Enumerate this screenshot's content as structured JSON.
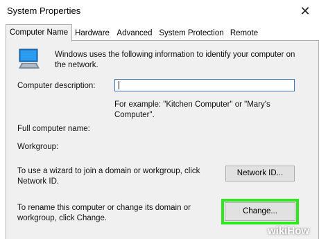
{
  "window": {
    "title": "System Properties",
    "close_glyph": "✕"
  },
  "tabs": [
    {
      "label": "Computer Name",
      "active": true
    },
    {
      "label": "Hardware",
      "active": false
    },
    {
      "label": "Advanced",
      "active": false
    },
    {
      "label": "System Protection",
      "active": false
    },
    {
      "label": "Remote",
      "active": false
    }
  ],
  "panel": {
    "icon": "computer-icon",
    "intro_line1": "Windows uses the following information to identify your computer on",
    "intro_line2": "the network.",
    "description_label": "Computer description:",
    "description_value": "",
    "example_line1": "For example: \"Kitchen Computer\" or \"Mary's",
    "example_line2": "Computer\".",
    "full_name_label": "Full computer name:",
    "workgroup_label": "Workgroup:",
    "wizard_line1": "To use a wizard to join a domain or workgroup, click",
    "wizard_line2": "Network ID.",
    "network_id_button": "Network ID...",
    "rename_line1": "To rename this computer or change its domain or",
    "rename_line2": "workgroup, click Change.",
    "change_button": "Change..."
  },
  "watermark": {
    "part1": "wiki",
    "part2": "How"
  },
  "colors": {
    "highlight": "#2ee81e",
    "panel_bg": "#f0f0f0",
    "input_border": "#3c78c0"
  }
}
